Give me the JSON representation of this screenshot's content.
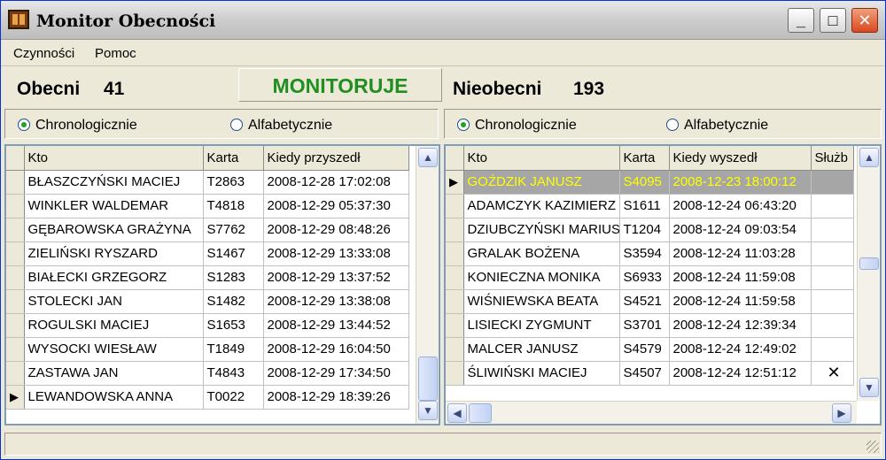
{
  "window": {
    "title": "Monitor Obecności",
    "minimize": "_",
    "maximize": "□",
    "close": "✕"
  },
  "menu": {
    "items": [
      "Czynności",
      "Pomoc"
    ]
  },
  "status_text": "MONITORUJE",
  "left": {
    "label": "Obecni",
    "count": "41",
    "radio_options": [
      "Chronologicznie",
      "Alfabetycznie"
    ],
    "radio_selected": "Chronologicznie",
    "columns": [
      "Kto",
      "Karta",
      "Kiedy przyszedł"
    ],
    "rows": [
      [
        "BŁASZCZYŃSKI MACIEJ",
        "T2863",
        "2008-12-28 17:02:08"
      ],
      [
        "WINKLER WALDEMAR",
        "T4818",
        "2008-12-29 05:37:30"
      ],
      [
        "GĘBAROWSKA GRAŻYNA",
        "S7762",
        "2008-12-29 08:48:26"
      ],
      [
        "ZIELIŃSKI RYSZARD",
        "S1467",
        "2008-12-29 13:33:08"
      ],
      [
        "BIAŁECKI GRZEGORZ",
        "S1283",
        "2008-12-29 13:37:52"
      ],
      [
        "STOLECKI JAN",
        "S1482",
        "2008-12-29 13:38:08"
      ],
      [
        "ROGULSKI MACIEJ",
        "S1653",
        "2008-12-29 13:44:52"
      ],
      [
        "WYSOCKI WIESŁAW",
        "T1849",
        "2008-12-29 16:04:50"
      ],
      [
        "ZASTAWA  JAN",
        "T4843",
        "2008-12-29 17:34:50"
      ],
      [
        "LEWANDOWSKA ANNA",
        "T0022",
        "2008-12-29 18:39:26"
      ]
    ]
  },
  "right": {
    "label": "Nieobecni",
    "count": "193",
    "radio_options": [
      "Chronologicznie",
      "Alfabetycznie"
    ],
    "radio_selected": "Chronologicznie",
    "columns": [
      "Kto",
      "Karta",
      "Kiedy wyszedł",
      "Służb"
    ],
    "rows": [
      [
        "GOŹDZIK JANUSZ",
        "S4095",
        "2008-12-23 18:00:12",
        ""
      ],
      [
        "ADAMCZYK KAZIMIERZ",
        "S1611",
        "2008-12-24 06:43:20",
        ""
      ],
      [
        "DZIUBCZYŃSKI MARIUSZ",
        "T1204",
        "2008-12-24 09:03:54",
        ""
      ],
      [
        "GRALAK BOŻENA",
        "S3594",
        "2008-12-24 11:03:28",
        ""
      ],
      [
        "KONIECZNA MONIKA",
        "S6933",
        "2008-12-24 11:59:08",
        ""
      ],
      [
        "WIŚNIEWSKA BEATA",
        "S4521",
        "2008-12-24 11:59:58",
        ""
      ],
      [
        "LISIECKI ZYGMUNT",
        "S3701",
        "2008-12-24 12:39:34",
        ""
      ],
      [
        "MALCER JANUSZ",
        "S4579",
        "2008-12-24 12:49:02",
        ""
      ],
      [
        "ŚLIWIŃSKI MACIEJ",
        "S4507",
        "2008-12-24 12:51:12",
        "✕"
      ]
    ]
  },
  "colors": {
    "monitor_text": "#1f8f1f",
    "highlight_row_bg": "#a6a6a6",
    "highlight_row_text": "#ffff00"
  }
}
